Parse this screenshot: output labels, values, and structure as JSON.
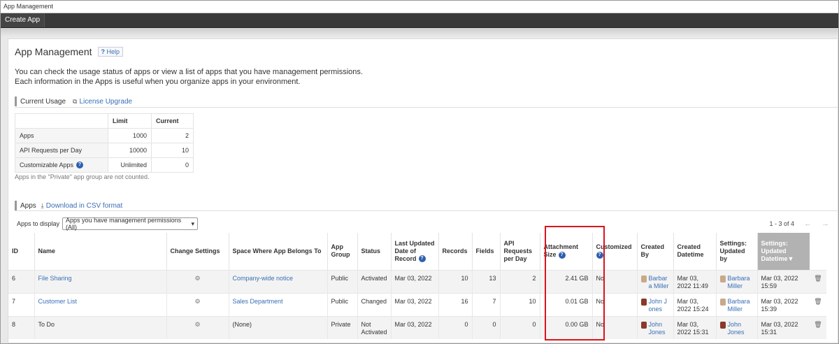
{
  "window": {
    "title": "App Management"
  },
  "topbar": {
    "create_app_label": "Create App"
  },
  "page": {
    "title": "App Management",
    "help_label": "Help",
    "description_line1": "You can check the usage status of apps or view a list of apps that you have management permissions.",
    "description_line2": "Each information in the Apps is useful when you organize apps in your environment."
  },
  "current_usage": {
    "section_label": "Current Usage",
    "license_link": "License Upgrade",
    "headers": [
      "",
      "Limit",
      "Current"
    ],
    "rows": [
      {
        "label": "Apps",
        "limit": "1000",
        "current": "2"
      },
      {
        "label": "API Requests per Day",
        "limit": "10000",
        "current": "10"
      },
      {
        "label": "Customizable Apps",
        "limit": "Unlimited",
        "current": "0"
      }
    ],
    "note": "Apps in the \"Private\" app group are not counted."
  },
  "apps_section": {
    "section_label": "Apps",
    "csv_link": "Download in CSV format",
    "filter_label": "Apps to display",
    "filter_value": "Apps you have management permissions (All)",
    "pager": "1 - 3 of 4",
    "headers": {
      "id": "ID",
      "name": "Name",
      "change_settings": "Change Settings",
      "space": "Space Where App Belongs To",
      "app_group": "App Group",
      "status": "Status",
      "last_updated": "Last Updated Date of Record",
      "records": "Records",
      "fields": "Fields",
      "api": "API Requests per Day",
      "attachment": "Attachment Size",
      "customized": "Customized",
      "created_by": "Created By",
      "created_datetime": "Created Datetime",
      "settings_updated_by": "Settings: Updated by",
      "settings_updated_datetime": "Settings: Updated Datetime"
    },
    "rows": [
      {
        "id": "6",
        "name": "File Sharing",
        "space": "Company-wide notice",
        "group": "Public",
        "status": "Activated",
        "last_updated": "Mar 03, 2022",
        "records": "10",
        "fields": "13",
        "api": "2",
        "attachment": "2.41 GB",
        "customized": "No",
        "created_by": "Barbara Miller",
        "created_dt": "Mar 03, 2022 11:49",
        "updated_by": "Barbara Miller",
        "updated_dt": "Mar 03, 2022 15:59"
      },
      {
        "id": "7",
        "name": "Customer List",
        "space": "Sales Department",
        "group": "Public",
        "status": "Changed",
        "last_updated": "Mar 03, 2022",
        "records": "16",
        "fields": "7",
        "api": "10",
        "attachment": "0.01 GB",
        "customized": "No",
        "created_by": "John Jones",
        "created_dt": "Mar 03, 2022 15:24",
        "updated_by": "Barbara Miller",
        "updated_dt": "Mar 03, 2022 15:39"
      },
      {
        "id": "8",
        "name": "To Do",
        "space": "(None)",
        "group": "Private",
        "status": "Not Activated",
        "last_updated": "Mar 03, 2022",
        "records": "0",
        "fields": "0",
        "api": "0",
        "attachment": "0.00 GB",
        "customized": "No",
        "created_by": "John Jones",
        "created_dt": "Mar 03, 2022 15:31",
        "updated_by": "John Jones",
        "updated_dt": "Mar 03, 2022 15:31"
      }
    ]
  },
  "colors": {
    "link": "#3a6fb5",
    "highlight": "#d9141c",
    "topbar": "#3a3a3a"
  }
}
